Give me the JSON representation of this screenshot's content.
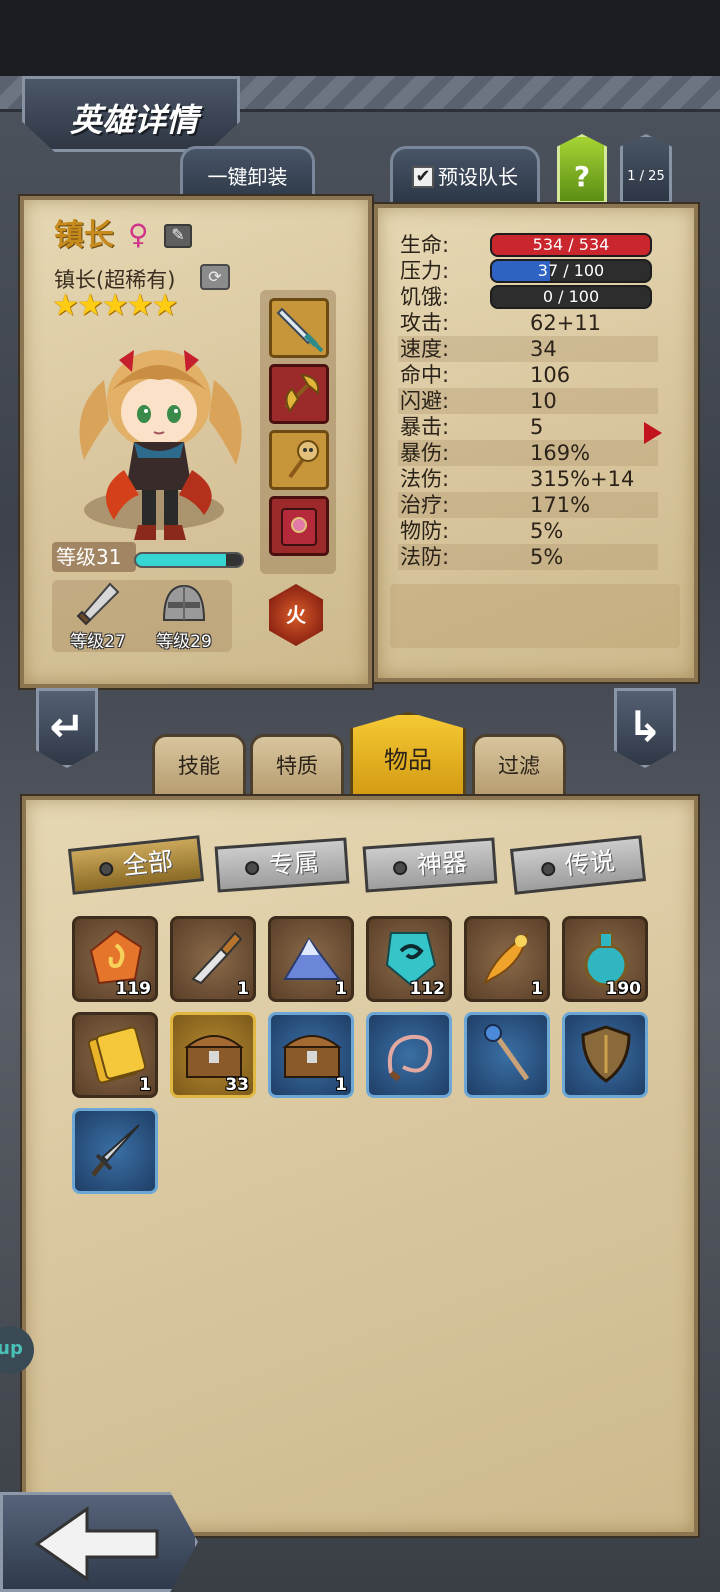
{
  "page_title": "英雄详情",
  "top_buttons": {
    "unequip_all": "一键卸装",
    "preset_leader": "预设队长",
    "preset_checked": "✔",
    "help": "?",
    "page_counter": "1 / 25"
  },
  "hero": {
    "name": "镇长",
    "gender_icon": "♀",
    "class": "镇长(超稀有)",
    "stars": "★★★★★",
    "star_count": 5,
    "level": "等级31",
    "xp_fraction": 0.85,
    "weapon_level": "等级27",
    "armor_level": "等级29",
    "element": "火"
  },
  "stats": {
    "hp": {
      "label": "生命:",
      "value": "534 / 534",
      "fraction": 1.0,
      "color": "#c9262e"
    },
    "stress": {
      "label": "压力:",
      "value": "37 / 100",
      "fraction": 0.37,
      "color": "#2e63c4"
    },
    "hunger": {
      "label": "饥饿:",
      "value": "0 / 100",
      "fraction": 0.0,
      "color": "#444444"
    },
    "rows": [
      {
        "label": "攻击:",
        "value": "62+11"
      },
      {
        "label": "速度:",
        "value": "34"
      },
      {
        "label": "命中:",
        "value": "106"
      },
      {
        "label": "闪避:",
        "value": "10"
      },
      {
        "label": "暴击:",
        "value": "5"
      },
      {
        "label": "暴伤:",
        "value": "169%"
      },
      {
        "label": "法伤:",
        "value": "315%+14"
      },
      {
        "label": "治疗:",
        "value": "171%"
      },
      {
        "label": "物防:",
        "value": "5%"
      },
      {
        "label": "法防:",
        "value": "5%"
      }
    ]
  },
  "tabs": [
    "技能",
    "特质",
    "物品",
    "过滤"
  ],
  "active_tab": "物品",
  "filters": [
    "全部",
    "专属",
    "神器",
    "传说"
  ],
  "active_filter": "全部",
  "items": [
    {
      "icon": "fire-gem-icon",
      "count": "119"
    },
    {
      "icon": "knife-icon",
      "count": "1"
    },
    {
      "icon": "crystal-pile-icon",
      "count": "1"
    },
    {
      "icon": "rune-stone-icon",
      "count": "112"
    },
    {
      "icon": "feather-icon",
      "count": "1"
    },
    {
      "icon": "potion-icon",
      "count": "190"
    },
    {
      "icon": "ticket-icon",
      "count": "1"
    },
    {
      "icon": "gold-chest-icon",
      "count": "33"
    },
    {
      "icon": "blue-chest-icon",
      "count": "1"
    },
    {
      "icon": "whip-icon",
      "count": ""
    },
    {
      "icon": "staff-icon",
      "count": ""
    },
    {
      "icon": "shield-icon",
      "count": ""
    },
    {
      "icon": "dagger-icon",
      "count": ""
    }
  ],
  "side_tab": "up"
}
